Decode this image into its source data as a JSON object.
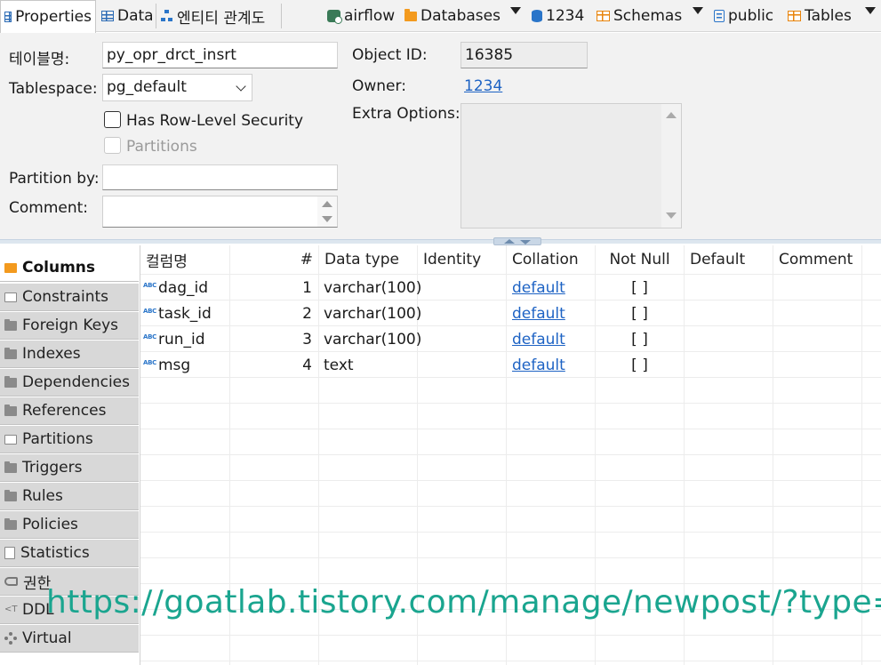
{
  "tabs": [
    {
      "label": "Properties",
      "icon": "properties-grid-icon",
      "active": true
    },
    {
      "label": "Data",
      "icon": "data-grid-icon",
      "active": false
    },
    {
      "label": "엔티티 관계도",
      "icon": "er-diagram-icon",
      "active": false
    }
  ],
  "breadcrumbs": {
    "connection": "airflow",
    "databases": "Databases",
    "database": "1234",
    "schemas": "Schemas",
    "schema": "public",
    "tables": "Tables"
  },
  "props": {
    "table_name_label": "테이블명:",
    "table_name_value": "py_opr_drct_insrt",
    "tablespace_label": "Tablespace:",
    "tablespace_value": "pg_default",
    "rls_label": "Has Row-Level Security",
    "partitions_label": "Partitions",
    "partition_by_label": "Partition by:",
    "partition_by_value": "",
    "comment_label": "Comment:",
    "comment_value": "",
    "object_id_label": "Object ID:",
    "object_id_value": "16385",
    "owner_label": "Owner:",
    "owner_value": "1234",
    "extra_options_label": "Extra Options:",
    "extra_options_value": ""
  },
  "nav": [
    {
      "label": "Columns",
      "icon": "columns-icon",
      "active": true
    },
    {
      "label": "Constraints",
      "icon": "constraints-icon"
    },
    {
      "label": "Foreign Keys",
      "icon": "foreign-keys-icon"
    },
    {
      "label": "Indexes",
      "icon": "indexes-icon"
    },
    {
      "label": "Dependencies",
      "icon": "dependencies-icon"
    },
    {
      "label": "References",
      "icon": "references-icon"
    },
    {
      "label": "Partitions",
      "icon": "partitions-icon"
    },
    {
      "label": "Triggers",
      "icon": "triggers-icon"
    },
    {
      "label": "Rules",
      "icon": "rules-icon"
    },
    {
      "label": "Policies",
      "icon": "policies-icon"
    },
    {
      "label": "Statistics",
      "icon": "statistics-icon"
    },
    {
      "label": "권한",
      "icon": "permissions-key-icon"
    },
    {
      "label": "DDL",
      "icon": "ddl-icon"
    },
    {
      "label": "Virtual",
      "icon": "virtual-icon"
    }
  ],
  "columns_table": {
    "headers": [
      "컬럼명",
      "#",
      "Data type",
      "Identity",
      "Collation",
      "Not Null",
      "Default",
      "Comment"
    ],
    "type_badge": "ABC",
    "rows": [
      {
        "name": "dag_id",
        "num": "1",
        "type": "varchar(100)",
        "identity": "",
        "collation": "default",
        "not_null": "[ ]",
        "default": "",
        "comment": ""
      },
      {
        "name": "task_id",
        "num": "2",
        "type": "varchar(100)",
        "identity": "",
        "collation": "default",
        "not_null": "[ ]",
        "default": "",
        "comment": ""
      },
      {
        "name": "run_id",
        "num": "3",
        "type": "varchar(100)",
        "identity": "",
        "collation": "default",
        "not_null": "[ ]",
        "default": "",
        "comment": ""
      },
      {
        "name": "msg",
        "num": "4",
        "type": "text",
        "identity": "",
        "collation": "default",
        "not_null": "[ ]",
        "default": "",
        "comment": ""
      }
    ]
  },
  "watermark": "https://goatlab.tistory.com/manage/newpost/?type=p",
  "colors": {
    "link": "#1e63c4",
    "watermark": "#1aa58f",
    "active_folder": "#f39a1e",
    "nav_bg": "#d8d8d8"
  }
}
